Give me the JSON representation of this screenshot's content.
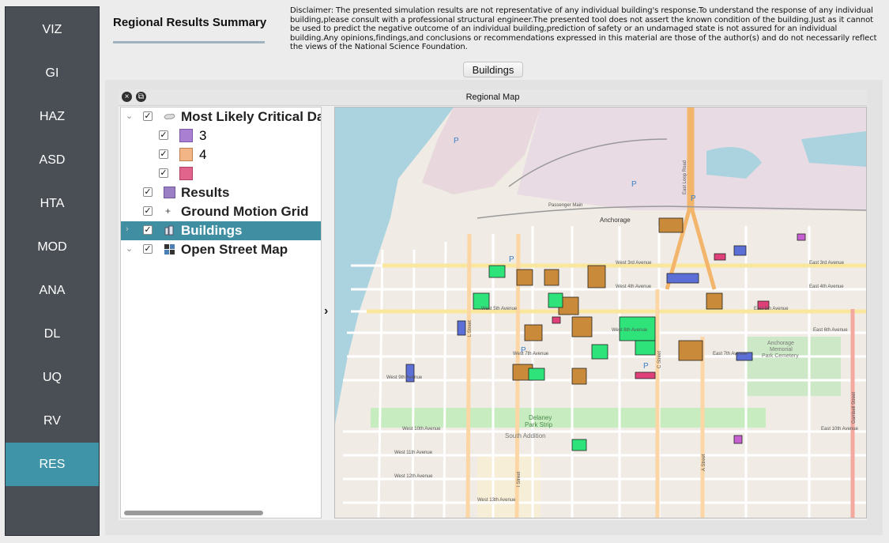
{
  "sidebar": {
    "items": [
      {
        "label": "VIZ",
        "active": false
      },
      {
        "label": "GI",
        "active": false
      },
      {
        "label": "HAZ",
        "active": false
      },
      {
        "label": "ASD",
        "active": false
      },
      {
        "label": "HTA",
        "active": false
      },
      {
        "label": "MOD",
        "active": false
      },
      {
        "label": "ANA",
        "active": false
      },
      {
        "label": "DL",
        "active": false
      },
      {
        "label": "UQ",
        "active": false
      },
      {
        "label": "RV",
        "active": false
      },
      {
        "label": "RES",
        "active": true
      }
    ]
  },
  "header": {
    "tab_title": "Regional Results Summary",
    "disclaimer": "Disclaimer: The presented simulation results are not representative of any individual building's response.To understand the response of any individual building,please consult with a professional structural engineer.The presented tool does not assert the known condition of the building.Just as it cannot be used to predict the negative outcome of an individual building,prediction of safety or an undamaged state is not assured for an individual building.Any opinions,findings,and conclusions or recommendations expressed in this material are those of the author(s) and do not necessarily reflect the views of the National Science Foundation."
  },
  "toolbar": {
    "buildings_button": "Buildings"
  },
  "dock": {
    "title": "Regional Map"
  },
  "layers": {
    "critical": {
      "label": "Most Likely Critical Da",
      "checked": true
    },
    "legend": [
      {
        "label": "3",
        "color": "#a97fd2",
        "checked": true
      },
      {
        "label": "4",
        "color": "#f2b585",
        "checked": true
      },
      {
        "label": "",
        "color": "#e0648b",
        "checked": true
      }
    ],
    "results": {
      "label": "Results",
      "color": "#9b7fc4",
      "checked": true
    },
    "ground_motion": {
      "label": "Ground Motion Grid",
      "checked": true
    },
    "buildings": {
      "label": "Buildings",
      "checked": true,
      "selected": true
    },
    "osm": {
      "label": "Open Street Map",
      "checked": true
    }
  },
  "map_labels": {
    "anchorage": "Anchorage",
    "delaney": "Delaney",
    "park_strip": "Park Strip",
    "south_addition": "South Addition",
    "cemetery_1": "Anchorage",
    "cemetery_2": "Memorial",
    "cemetery_3": "Park Cemetery",
    "w3": "West 3rd Avenue",
    "w4": "West 4th Avenue",
    "w5": "West 5th Avenue",
    "w6": "West 6th Avenue",
    "w7": "West 7th Avenue",
    "w9": "West 9th Avenue",
    "w10": "West 10th Avenue",
    "w11": "West 11th Avenue",
    "w12": "West 12th Avenue",
    "w13": "West 13th Avenue",
    "e3": "East 3rd Avenue",
    "e4": "East 4th Avenue",
    "e5": "East 5th Avenue",
    "e6": "East 6th Avenue",
    "e7": "East 7th Avenue",
    "e10": "East 10th Avenue",
    "cst": "C Street",
    "lst": "L Street",
    "ist": "I Street",
    "ast": "A Street",
    "gambell": "Gambell Street",
    "passenger": "Passenger Main",
    "elost": "East Loop Road"
  }
}
